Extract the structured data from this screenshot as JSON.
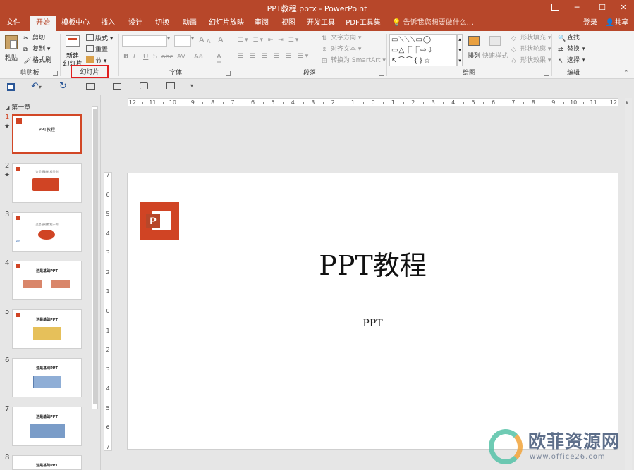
{
  "window": {
    "title": "PPT教程.pptx - PowerPoint"
  },
  "tabs": [
    {
      "id": "file",
      "label": "文件"
    },
    {
      "id": "home",
      "label": "开始"
    },
    {
      "id": "template",
      "label": "模板中心"
    },
    {
      "id": "insert",
      "label": "插入"
    },
    {
      "id": "design",
      "label": "设计"
    },
    {
      "id": "transitions",
      "label": "切换"
    },
    {
      "id": "animations",
      "label": "动画"
    },
    {
      "id": "slideshow",
      "label": "幻灯片放映"
    },
    {
      "id": "review",
      "label": "审阅"
    },
    {
      "id": "view",
      "label": "视图"
    },
    {
      "id": "developer",
      "label": "开发工具"
    },
    {
      "id": "pdf",
      "label": "PDF工具集"
    }
  ],
  "tell_me": "告诉我您想要做什么...",
  "account": {
    "signin": "登录",
    "share": "共享"
  },
  "ribbon": {
    "clipboard": {
      "paste": "粘贴",
      "cut": "剪切",
      "copy": "复制",
      "format_painter": "格式刷",
      "label": "剪贴板"
    },
    "slides": {
      "new_slide_line1": "新建",
      "new_slide_line2": "幻灯片",
      "layout": "版式",
      "reset": "重置",
      "section": "节",
      "label": "幻灯片"
    },
    "font": {
      "bold": "B",
      "italic": "I",
      "underline": "U",
      "strike": "S",
      "shadow": "abc",
      "spacing": "AV",
      "case": "Aa",
      "color": "A",
      "grow": "A",
      "shrink": "A",
      "clear": "A",
      "label": "字体"
    },
    "paragraph": {
      "text_direction": "文字方向",
      "align_text": "对齐文本",
      "smartart": "转换为 SmartArt",
      "label": "段落"
    },
    "drawing": {
      "arrange": "排列",
      "quick_styles": "快速样式",
      "shape_fill": "形状填充",
      "shape_outline": "形状轮廓",
      "shape_effects": "形状效果",
      "label": "绘图"
    },
    "editing": {
      "find": "查找",
      "replace": "替换",
      "select": "选择",
      "label": "编辑"
    }
  },
  "outline": {
    "section": "第一章"
  },
  "slides": [
    {
      "num": "1",
      "star": "★",
      "title": "PPT教程"
    },
    {
      "num": "2",
      "star": "★",
      "title": "这是基础教程示例"
    },
    {
      "num": "3",
      "star": "",
      "title": "这是基础教程示例"
    },
    {
      "num": "4",
      "star": "",
      "title": "这是基础PPT"
    },
    {
      "num": "5",
      "star": "",
      "title": "这是基础PPT"
    },
    {
      "num": "6",
      "star": "",
      "title": "这是基础PPT"
    },
    {
      "num": "7",
      "star": "",
      "title": "这是基础PPT"
    },
    {
      "num": "8",
      "star": "",
      "title": "这是基础PPT"
    }
  ],
  "main_slide": {
    "title": "PPT教程",
    "subtitle": "PPT"
  },
  "ruler": {
    "h_labels": [
      "12",
      "11",
      "10",
      "9",
      "8",
      "7",
      "6",
      "5",
      "4",
      "3",
      "2",
      "1",
      "0",
      "1",
      "2",
      "3",
      "4",
      "5",
      "6",
      "7",
      "8",
      "9",
      "10",
      "11",
      "12"
    ],
    "v_labels": [
      "7",
      "6",
      "5",
      "4",
      "3",
      "2",
      "1",
      "0",
      "1",
      "2",
      "3",
      "4",
      "5",
      "6",
      "7"
    ]
  },
  "watermark": {
    "text": "欧菲资源网",
    "url": "www.office26.com"
  },
  "colors": {
    "accent": "#b7472a",
    "logo": "#d04424",
    "highlight": "#e02020"
  }
}
